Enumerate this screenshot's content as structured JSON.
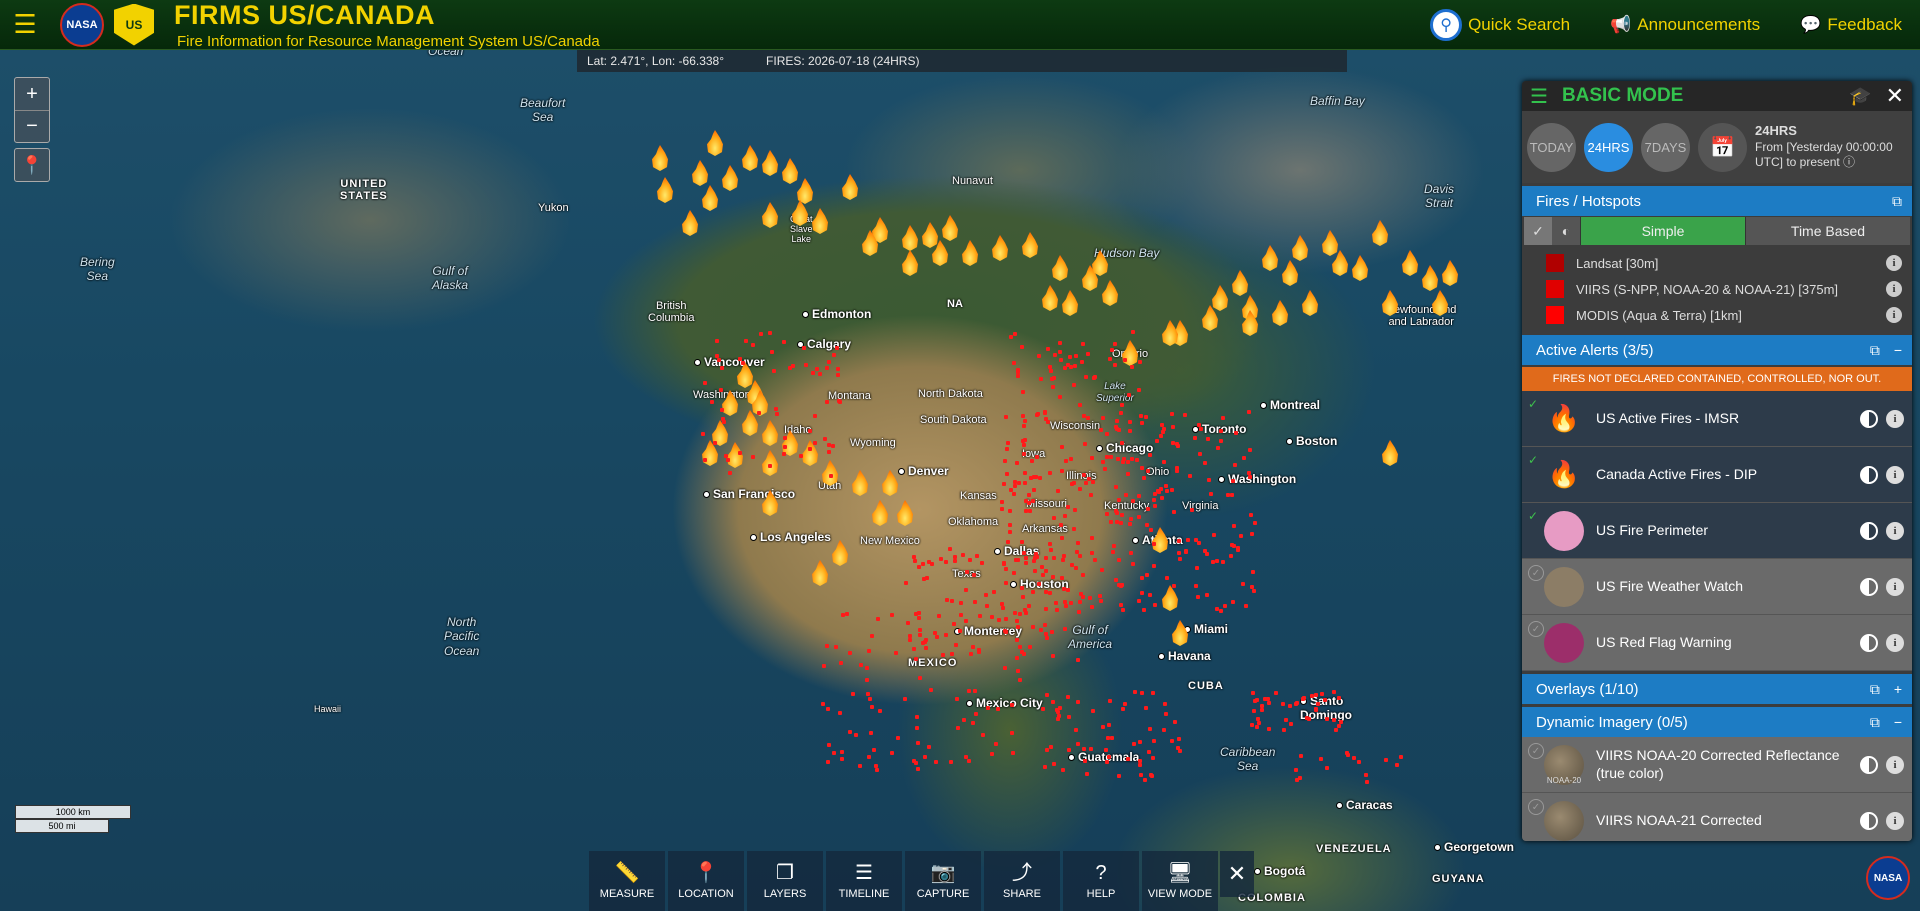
{
  "header": {
    "title": "FIRMS US/CANADA",
    "subtitle": "Fire Information for Resource Management System US/Canada",
    "nasa_logo": "NASA",
    "usda_logo": "US",
    "quick_search": "Quick Search",
    "announcements": "Announcements",
    "feedback": "Feedback"
  },
  "map": {
    "coordinates": "Lat: 2.471°, Lon: -66.338°",
    "fires_date": "FIRES: 2026-07-18 (24HRS)",
    "zoom_in": "+",
    "zoom_out": "−",
    "scale_km": "1000 km",
    "scale_mi": "500 mi",
    "labels": {
      "ocean_top": "Ocean",
      "beaufort": "Beaufort\nSea",
      "baffin": "Baffin Bay",
      "bering": "Bering\nSea",
      "gulf_alaska": "Gulf of\nAlaska",
      "hudson": "Hudson Bay",
      "davis": "Davis\nStrait",
      "north_pacific": "North\nPacific\nOcean",
      "gulf_mexico": "Gulf of\nAmerica",
      "caribbean": "Caribbean\nSea",
      "us": "UNITED\nSTATES",
      "yukon": "Yukon",
      "nunavut": "Nunavut",
      "british_columbia": "British\nColumbia",
      "ontario": "Ontario",
      "lake_superior": "Lake\nSuperior",
      "montana": "Montana",
      "north_dakota": "North Dakota",
      "south_dakota": "South Dakota",
      "idaho": "Idaho",
      "wyoming": "Wyoming",
      "kansas": "Kansas",
      "missouri": "Missouri",
      "oklahoma": "Oklahoma",
      "arkansas": "Arkansas",
      "iowa": "Iowa",
      "illinois": "Illinois",
      "ohio": "Ohio",
      "kentucky": "Kentucky",
      "wisconsin": "Wisconsin",
      "virginia": "Virginia",
      "texas": "Texas",
      "new_mexico": "New Mexico",
      "washington_st": "Washington",
      "utah": "Utah",
      "newfoundland": "Newfoundland\nand Labrador",
      "great_slave": "Great\nSlave\nLake",
      "mexico": "MEXICO",
      "cuba": "CUBA",
      "venezuela": "VENEZUELA",
      "colombia": "COLOMBIA",
      "guyana": "GUYANA",
      "hawaii": "Hawaii",
      "na_partial": "NA"
    },
    "cities": {
      "edmonton": "Edmonton",
      "calgary": "Calgary",
      "vancouver": "Vancouver",
      "san_francisco": "San Francisco",
      "los_angeles": "Los Angeles",
      "denver": "Denver",
      "dallas": "Dallas",
      "houston": "Houston",
      "chicago": "Chicago",
      "toronto": "Toronto",
      "montreal": "Montreal",
      "boston": "Boston",
      "washington": "Washington",
      "atlanta": "Atlanta",
      "miami": "Miami",
      "havana": "Havana",
      "monterrey": "Monterrey",
      "mexico_city": "Mexico City",
      "guatemala": "Guatemala",
      "santo_domingo": "Santo\nDomingo",
      "caracas": "Caracas",
      "bogota": "Bogotá",
      "georgetown": "Georgetown"
    }
  },
  "toolbar": [
    {
      "label": "MEASURE",
      "icon": "ruler-icon",
      "glyph": "📏"
    },
    {
      "label": "LOCATION",
      "icon": "location-pin-icon",
      "glyph": "📍"
    },
    {
      "label": "LAYERS",
      "icon": "layers-icon",
      "glyph": "❐"
    },
    {
      "label": "TIMELINE",
      "icon": "sliders-icon",
      "glyph": "☰"
    },
    {
      "label": "CAPTURE",
      "icon": "camera-icon",
      "glyph": "📷"
    },
    {
      "label": "SHARE",
      "icon": "share-icon",
      "glyph": "⤴"
    },
    {
      "label": "HELP",
      "icon": "help-icon",
      "glyph": "?"
    },
    {
      "label": "VIEW MODE",
      "icon": "monitor-icon",
      "glyph": "🖥"
    }
  ],
  "panel": {
    "mode": "BASIC MODE",
    "time_buttons": [
      "TODAY",
      "24HRS",
      "7DAYS"
    ],
    "active_time": "24HRS",
    "time_info_title": "24HRS",
    "time_info_line1": "From [Yesterday 00:00:00",
    "time_info_line2": "UTC] to present",
    "fires_header": "Fires / Hotspots",
    "simple": "Simple",
    "time_based": "Time Based",
    "legend": [
      {
        "label": "Landsat [30m]",
        "color": "#b00000"
      },
      {
        "label": "VIIRS (S-NPP, NOAA-20 & NOAA-21) [375m]",
        "color": "#e00000"
      },
      {
        "label": "MODIS (Aqua & Terra) [1km]",
        "color": "#ff0000"
      }
    ],
    "alerts_header": "Active Alerts (3/5)",
    "alerts_warning": "FIRES NOT DECLARED CONTAINED, CONTROLLED, NOR OUT.",
    "alerts": [
      {
        "label": "US Active Fires - IMSR",
        "on": true
      },
      {
        "label": "Canada Active Fires - DIP",
        "on": true
      },
      {
        "label": "US Fire Perimeter",
        "on": true,
        "color": "#e79bc4"
      },
      {
        "label": "US Fire Weather Watch",
        "on": false,
        "color": "#8c7d66"
      },
      {
        "label": "US Red Flag Warning",
        "on": false,
        "color": "#9c2e6a"
      }
    ],
    "overlays_header": "Overlays (1/10)",
    "imagery_header": "Dynamic Imagery (0/5)",
    "imagery": [
      {
        "label": "VIIRS NOAA-20 Corrected Reflectance (true color)",
        "badge": "NOAA-20"
      },
      {
        "label": "VIIRS NOAA-21 Corrected",
        "badge": ""
      }
    ]
  }
}
